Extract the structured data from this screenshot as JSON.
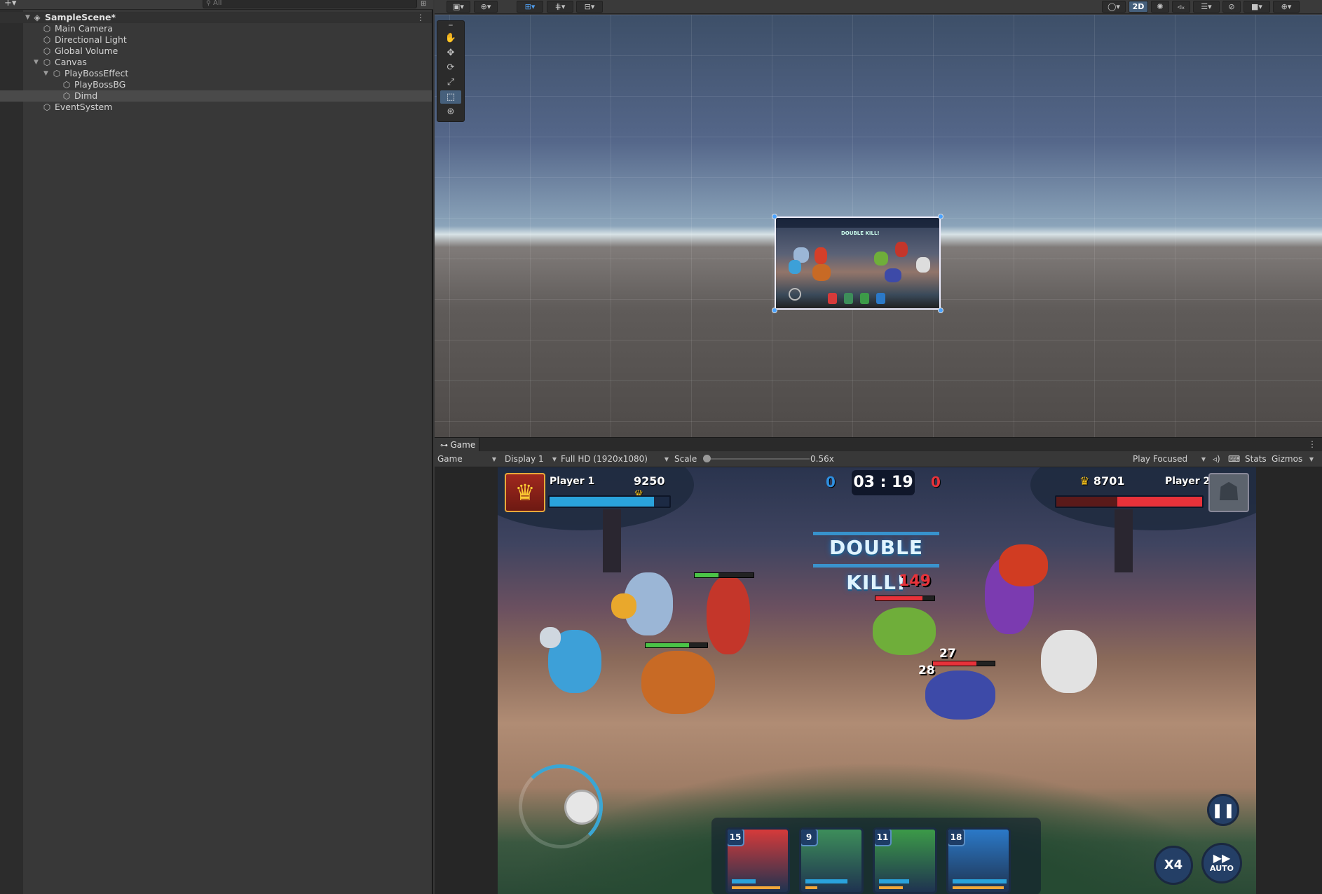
{
  "hierarchy": {
    "search_placeholder": "All",
    "scene_name": "SampleScene*",
    "items": [
      {
        "label": "Main Camera"
      },
      {
        "label": "Directional Light"
      },
      {
        "label": "Global Volume"
      },
      {
        "label": "Canvas"
      },
      {
        "label": "PlayBossEffect"
      },
      {
        "label": "PlayBossBG"
      },
      {
        "label": "Dimd"
      },
      {
        "label": "EventSystem"
      }
    ],
    "selected_item": "Dimd"
  },
  "scene_toolbar": {
    "mode_2d_label": "2D"
  },
  "scene_thumbnail": {
    "banner_text": "DOUBLE KILL!"
  },
  "game_panel": {
    "tab_label": "Game",
    "view_select": "Game",
    "display_select": "Display 1",
    "resolution_select": "Full HD (1920x1080)",
    "scale_label": "Scale",
    "scale_value": "0.56x",
    "play_mode": "Play Focused",
    "stats_label": "Stats",
    "gizmos_label": "Gizmos"
  },
  "game": {
    "player1": {
      "name": "Player 1",
      "trophies": "9250",
      "hp_fraction": 0.87
    },
    "player2": {
      "name": "Player 2",
      "trophies": "8701",
      "hp_fraction": 0.58
    },
    "kills_left": "0",
    "kills_right": "0",
    "timer": "03 : 19",
    "banner": "DOUBLE KILL!",
    "damage_numbers": [
      "149",
      "27",
      "28"
    ],
    "cards": [
      {
        "level": "15",
        "color": "#d63a3a"
      },
      {
        "level": "9",
        "color": "#3d8e5a"
      },
      {
        "level": "11",
        "color": "#3c9a48"
      },
      {
        "level": "18",
        "color": "#2b79c8"
      }
    ],
    "speed_label": "X4",
    "auto_label": "AUTO",
    "colors": {
      "accent_blue": "#2aa3dc",
      "enemy_red": "#e8323a",
      "gold": "#f6c21d"
    }
  }
}
